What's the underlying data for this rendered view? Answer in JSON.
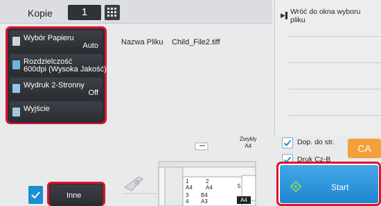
{
  "top": {
    "copies_label": "Kopie",
    "copies_value": "1"
  },
  "functions": [
    {
      "label": "Wybór Papieru",
      "value": "Auto"
    },
    {
      "label": "Rozdzielczość",
      "value": "600dpi (Wysoka Jakość)"
    },
    {
      "label": "Wydruk 2-Stronny",
      "value": "Off"
    },
    {
      "label": "Wyjście",
      "value": ""
    }
  ],
  "file": {
    "label": "Nazwa Pliku",
    "value": "Child_File2.tiff"
  },
  "right_panel": {
    "back_label": "Wróć do okna wyboru pliku"
  },
  "preview": {
    "paper_type": "Zwykły",
    "paper_size": "A4",
    "trays": [
      {
        "num": "1",
        "size": "A4"
      },
      {
        "num": "2",
        "size": "A4"
      },
      {
        "num": "3",
        "size": "B4"
      },
      {
        "num": "4",
        "size": "A3"
      },
      {
        "num": "5",
        "size": "A4"
      }
    ]
  },
  "options": {
    "dop_do_str": "Dop. do str.",
    "druk_cz_b": "Druk Cz-B"
  },
  "buttons": {
    "ca": "CA",
    "start": "Start",
    "inne": "Inne"
  },
  "colors": {
    "highlight": "#e0112a",
    "start": "#2a92dc",
    "ca": "#f2a03b"
  }
}
